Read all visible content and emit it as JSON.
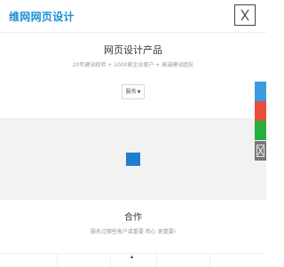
{
  "header": {
    "logo_text": "维网网页设计"
  },
  "hero": {
    "title": "网页设计产品",
    "subtitle": "20年建站经验 + 1000家企业客户 + 高端建站团队",
    "service_select": "服务"
  },
  "cooperation": {
    "title": "合作",
    "subtitle": "服务过哪些客户或重要 用心 更重要!"
  },
  "colors": {
    "brand_blue": "#1a8fd6",
    "loader_blue": "#1e7fd0",
    "float_qq": "#3b9be0",
    "float_phone": "#e74c3c",
    "float_wechat": "#27ae3c",
    "float_close": "#777777",
    "showcase_bg": "#f2f2f2"
  },
  "icons": {
    "menu": "close-x-icon",
    "float_close": "close-x-icon",
    "select_caret": "caret-down-icon"
  }
}
